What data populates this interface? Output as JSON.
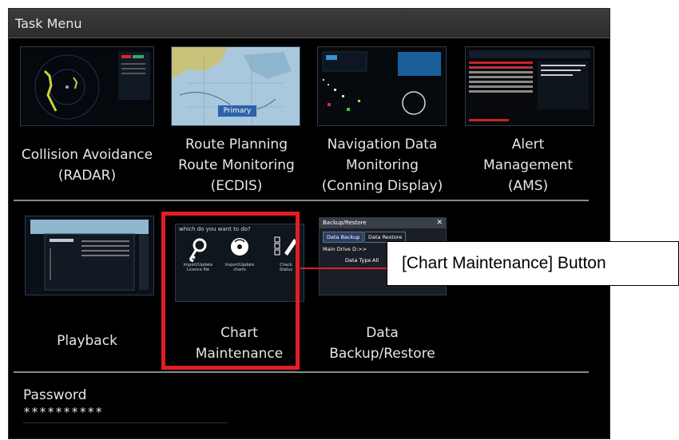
{
  "window": {
    "title": "Task Menu"
  },
  "tiles": [
    {
      "name": "collision-avoidance",
      "lines": [
        "Collision Avoidance",
        "(RADAR)"
      ]
    },
    {
      "name": "route-planning",
      "lines": [
        "Route Planning",
        "Route Monitoring",
        "(ECDIS)"
      ],
      "badge": "Primary"
    },
    {
      "name": "navigation-data",
      "lines": [
        "Navigation Data",
        "Monitoring",
        "(Conning Display)"
      ]
    },
    {
      "name": "alert-management",
      "lines": [
        "Alert",
        "Management",
        "(AMS)"
      ]
    },
    {
      "name": "playback",
      "lines": [
        "Playback"
      ]
    },
    {
      "name": "chart-maintenance",
      "lines": [
        "Chart",
        "Maintenance"
      ]
    },
    {
      "name": "data-backup-restore",
      "lines": [
        "Data",
        "Backup/Restore"
      ]
    }
  ],
  "chart_maintenance_thumb": {
    "header": "which do you want to do?",
    "options": [
      {
        "icon": "key-icon",
        "caption": [
          "Import/Update",
          "Licence file"
        ]
      },
      {
        "icon": "disc-icon",
        "caption": [
          "Import/Update",
          "charts"
        ]
      },
      {
        "icon": "checklist-icon",
        "caption": [
          "Check",
          "Status"
        ]
      }
    ]
  },
  "data_backup_thumb": {
    "title": "Backup/Restore",
    "tabs": [
      "Data Backup",
      "Data Restore"
    ],
    "main_drive": "Main Drive D:>>",
    "data_type_label": "Data Type",
    "data_type_value": "All"
  },
  "callout": {
    "text": "[Chart Maintenance] Button"
  },
  "password": {
    "label": "Password",
    "value": "**********"
  },
  "colors": {
    "highlight": "#e01e24",
    "background": "#000000",
    "text": "#e6e6e6"
  }
}
